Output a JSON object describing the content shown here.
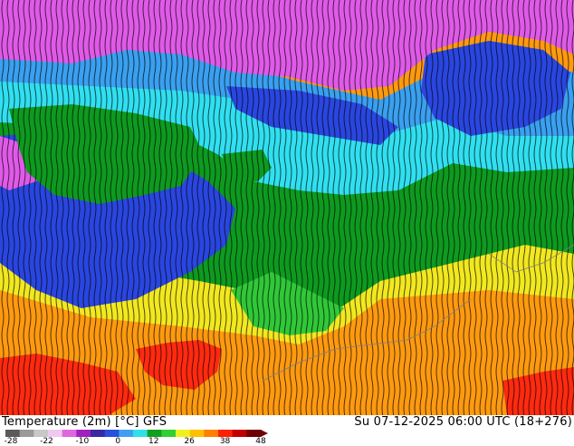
{
  "title": {
    "variable": "Temperature (2m) [°C]",
    "model": "GFS",
    "datetime": "Su 07-12-2025 06:00 UTC (18+276)"
  },
  "legend": {
    "ticks": [
      "-28",
      "-22",
      "-10",
      "0",
      "12",
      "26",
      "38",
      "48"
    ],
    "colors": [
      "#5a5a5a",
      "#9a9a9a",
      "#c8c8c8",
      "#f0c8f0",
      "#e066e0",
      "#a020c0",
      "#3a2aa0",
      "#2850e0",
      "#40a0f0",
      "#30e0e8",
      "#10a020",
      "#30d030",
      "#f0f020",
      "#ffc000",
      "#ff8000",
      "#ff2000",
      "#c00000",
      "#700000"
    ]
  },
  "map_colors": {
    "magenta": "#e05ae8",
    "blue": "#2a46e0",
    "lightblue": "#3aa0f0",
    "cyan": "#30e0f0",
    "green": "#0e9a20",
    "lightgreen": "#30c838",
    "yellow": "#f2e820",
    "orange": "#ff9a10",
    "red": "#ff2a10",
    "contour": "#000000",
    "border": "#808080"
  }
}
